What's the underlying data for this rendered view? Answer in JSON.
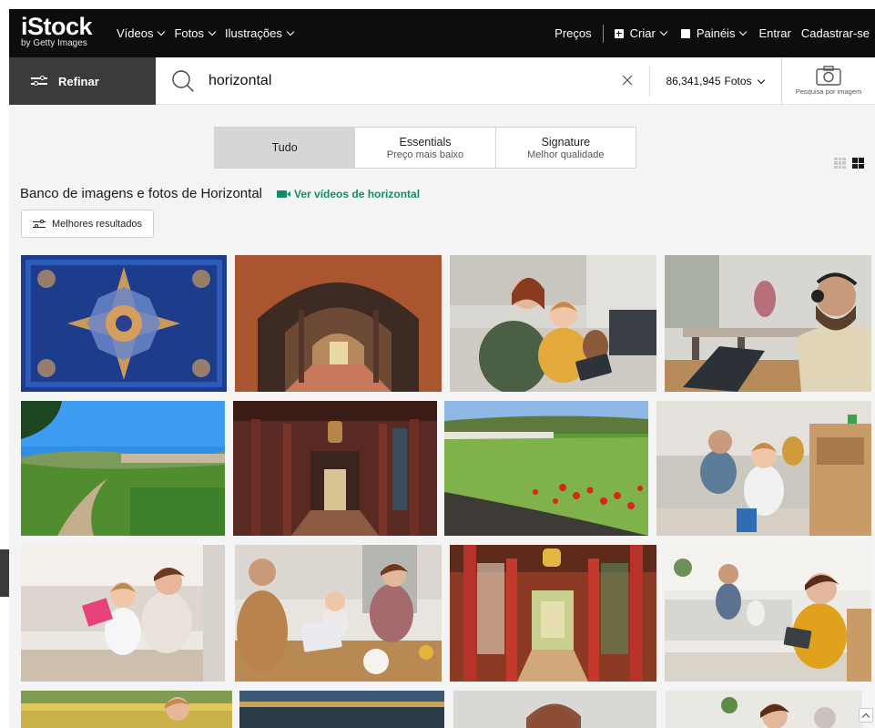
{
  "brand": {
    "name": "iStock",
    "sub": "by Getty Images"
  },
  "nav": {
    "left": [
      {
        "label": "Vídeos",
        "has_menu": true
      },
      {
        "label": "Fotos",
        "has_menu": true
      },
      {
        "label": "Ilustrações",
        "has_menu": true
      }
    ],
    "pricing": "Preços",
    "create": "Criar",
    "boards": "Painéis",
    "login": "Entrar",
    "signup": "Cadastrar-se"
  },
  "search": {
    "refine_label": "Refinar",
    "query": "horizontal",
    "result_count": "86,341,945",
    "asset_type": "Fotos",
    "camera_label": "Pesquisa por imagem"
  },
  "tabs": [
    {
      "title": "Tudo",
      "subtitle": "",
      "active": true
    },
    {
      "title": "Essentials",
      "subtitle": "Preço mais baixo",
      "active": false
    },
    {
      "title": "Signature",
      "subtitle": "Melhor qualidade",
      "active": false
    }
  ],
  "results": {
    "heading": "Banco de imagens e fotos de Horizontal",
    "video_link": "Ver vídeos de horizontal",
    "sort_label": "Melhores resultados"
  },
  "colors": {
    "nav_bg": "#0c0d0d",
    "accent_green": "#0f8c6a",
    "page_bg": "#f4f4f4"
  },
  "images": [
    {
      "subject": "blue ornamental mandala ceiling"
    },
    {
      "subject": "brick archway corridor"
    },
    {
      "subject": "mother and daughter with tablet on sofa"
    },
    {
      "subject": "man with headset working on laptop"
    },
    {
      "subject": "rural path with green field and village"
    },
    {
      "subject": "temple corridor with lanterns"
    },
    {
      "subject": "meadow with red poppies"
    },
    {
      "subject": "father and toddler playing in living room"
    },
    {
      "subject": "mother and daughter in bedroom"
    },
    {
      "subject": "family in kitchen with laptop"
    },
    {
      "subject": "red pillar temple corridor"
    },
    {
      "subject": "woman with tablet on living room floor"
    },
    {
      "subject": "golden field with child"
    },
    {
      "subject": "traditional roof"
    },
    {
      "subject": "woman portrait"
    },
    {
      "subject": "woman at home"
    }
  ]
}
